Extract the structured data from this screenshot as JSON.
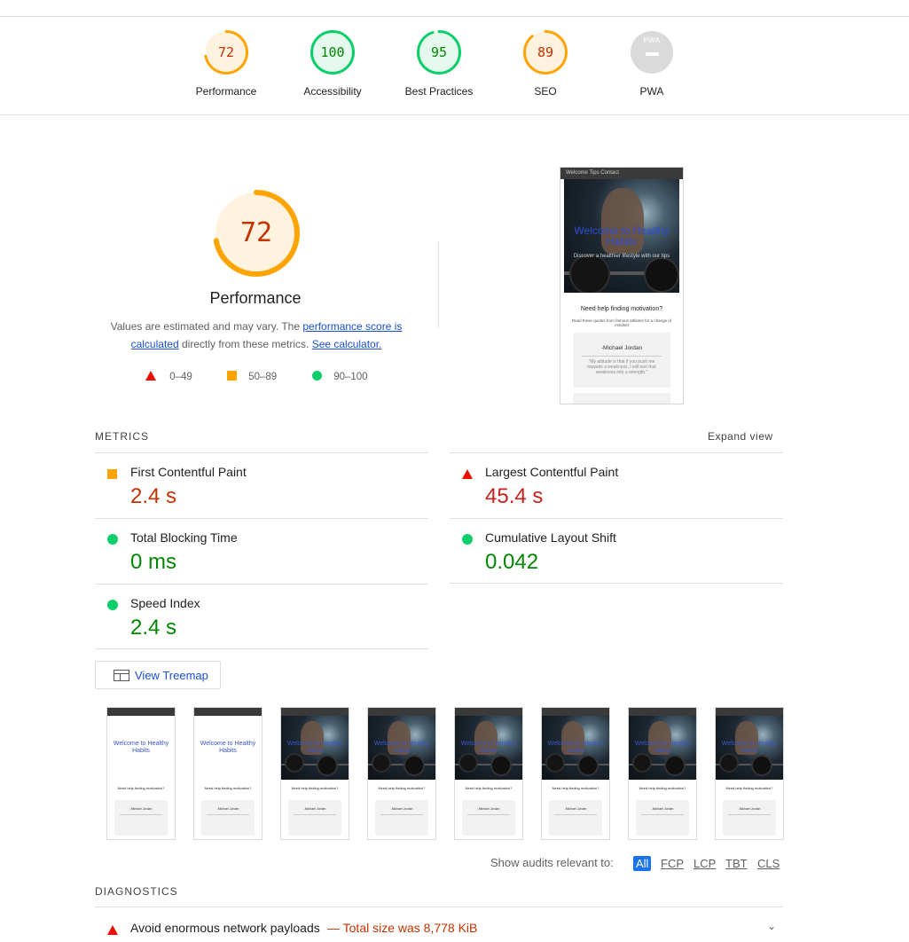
{
  "categories": [
    {
      "label": "Performance",
      "score": "72",
      "value": 0.72,
      "color": "#ffa400",
      "bg": "#fff3e0",
      "text": "#c33300"
    },
    {
      "label": "Accessibility",
      "score": "100",
      "value": 1.0,
      "color": "#0cce6b",
      "bg": "#e6f9ee",
      "text": "#008800"
    },
    {
      "label": "Best Practices",
      "score": "95",
      "value": 0.95,
      "color": "#0cce6b",
      "bg": "#e6f9ee",
      "text": "#008800"
    },
    {
      "label": "SEO",
      "score": "89",
      "value": 0.89,
      "color": "#ffa400",
      "bg": "#fff3e0",
      "text": "#c33300"
    },
    {
      "label": "PWA",
      "score": "PWA",
      "value": 0,
      "color": "#dadada",
      "bg": "#dadada",
      "text": "#ffffff"
    }
  ],
  "performance": {
    "score": "72",
    "value": 0.72,
    "title": "Performance",
    "desc_1": "Values are estimated and may vary. The ",
    "desc_link1": "performance score is calculated",
    "desc_2": " directly from these metrics. ",
    "desc_link2": "See calculator."
  },
  "legend": [
    {
      "shape": "triangle",
      "range": "0–49"
    },
    {
      "shape": "square",
      "range": "50–89"
    },
    {
      "shape": "circle",
      "range": "90–100"
    }
  ],
  "final_screenshot": {
    "header": "Welcome Tips Contact",
    "hero_title": "Welcome to Healthy Habits",
    "hero_sub": "Discover a healthier lifestyle with our tips",
    "section_title": "Need help finding motivation?",
    "section_text": "Read these quotes from famous athletes for a change of mindset",
    "quote_name": "-Michael Jordan",
    "quote_text": "\"My attitude is that if you push me towards a weakness, I will turn that weakness into a strength.\""
  },
  "metrics": {
    "title": "METRICS",
    "expand": "Expand view",
    "items": [
      {
        "name": "First Contentful Paint",
        "value": "2.4 s",
        "rating": "average"
      },
      {
        "name": "Largest Contentful Paint",
        "value": "45.4 s",
        "rating": "fail"
      },
      {
        "name": "Total Blocking Time",
        "value": "0 ms",
        "rating": "pass"
      },
      {
        "name": "Cumulative Layout Shift",
        "value": "0.042",
        "rating": "pass"
      },
      {
        "name": "Speed Index",
        "value": "2.4 s",
        "rating": "pass"
      }
    ]
  },
  "treemap": {
    "label": "View Treemap"
  },
  "filmstrip": {
    "frames": [
      {
        "image": false,
        "title": "Welcome to Healthy Habits"
      },
      {
        "image": false,
        "title": "Welcome to Healthy Habits"
      },
      {
        "image": true,
        "title": "Welcome to Healthy Habits"
      },
      {
        "image": true,
        "title": "Welcome to Healthy Habits"
      },
      {
        "image": true,
        "title": "Welcome to Healthy Habits"
      },
      {
        "image": true,
        "title": "Welcome to Healthy Habits"
      },
      {
        "image": true,
        "title": "Welcome to Healthy Habits"
      },
      {
        "image": true,
        "title": "Welcome to Healthy Habits"
      }
    ],
    "section_title": "Need help finding motivation?",
    "quote_name": "-Michael Jordan"
  },
  "audit_filter": {
    "label": "Show audits relevant to:",
    "options": [
      "All",
      "FCP",
      "LCP",
      "TBT",
      "CLS"
    ],
    "active": "All"
  },
  "diagnostics": {
    "title": "DIAGNOSTICS",
    "items": [
      {
        "title": "Avoid enormous network payloads",
        "detail": "— Total size was 8,778 KiB",
        "rating": "fail"
      }
    ]
  },
  "colors": {
    "pass": "#008800",
    "average": "#c33300",
    "fail": "#c7221f",
    "link": "#1a4fd0"
  }
}
